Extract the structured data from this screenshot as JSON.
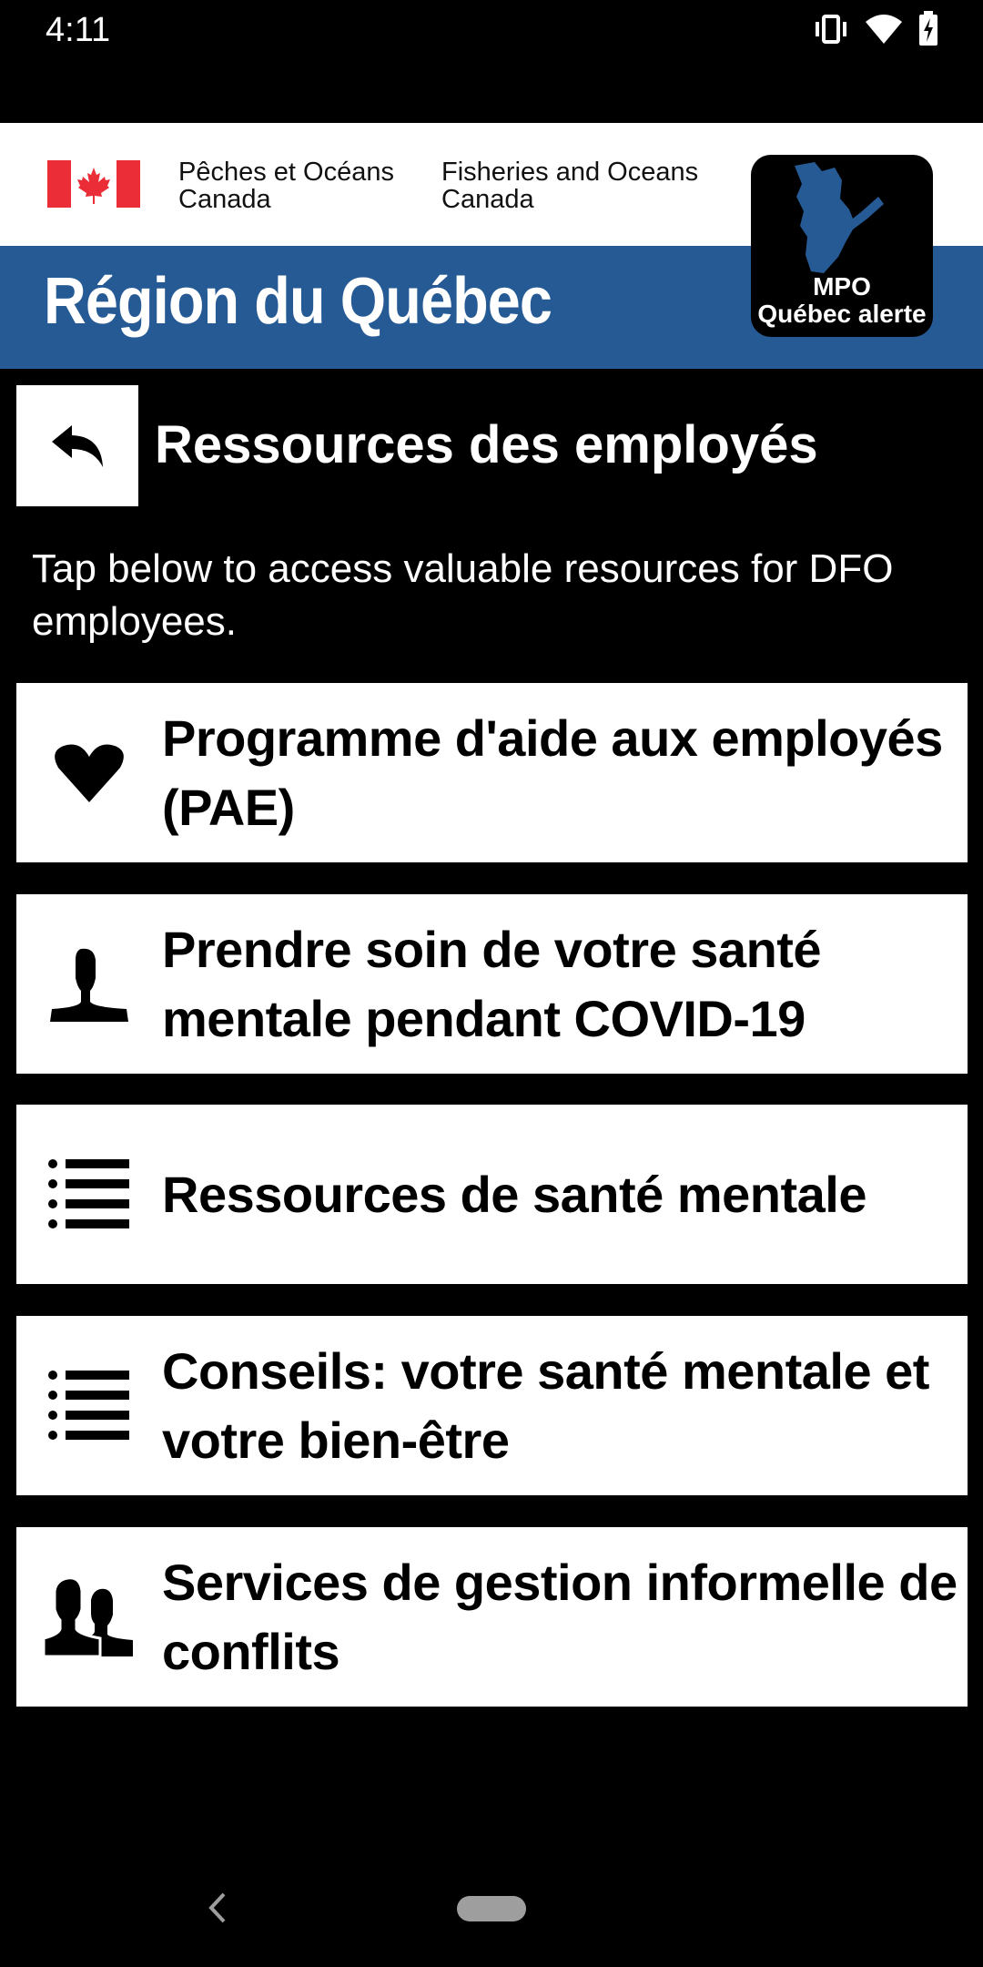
{
  "status_bar": {
    "time": "4:11",
    "icons": [
      "vibrate-icon",
      "wifi-icon",
      "battery-charging-icon"
    ]
  },
  "banner": {
    "department_fr": [
      "Pêches et Océans",
      "Canada"
    ],
    "department_en": [
      "Fisheries and Oceans",
      "Canada"
    ],
    "region_title": "Région du Québec",
    "logo": {
      "line1": "MPO",
      "line2": "Québec alerte"
    },
    "colors": {
      "banner_blue": "#265a94",
      "flag_red": "#eb2d37"
    }
  },
  "header": {
    "back_icon": "reply-arrow-icon",
    "title": "Ressources des employés"
  },
  "description": "Tap below to access valuable resources for DFO employees.",
  "resources": [
    {
      "icon": "heart-icon",
      "label": "Programme d'aide aux employés (PAE)"
    },
    {
      "icon": "person-icon",
      "label": "Prendre soin de votre santé mentale pendant COVID-19"
    },
    {
      "icon": "list-icon",
      "label": "Ressources de santé mentale"
    },
    {
      "icon": "list-icon",
      "label": "Conseils: votre santé mentale et votre bien-être"
    },
    {
      "icon": "group-icon",
      "label": "Services de gestion informelle de conflits"
    }
  ],
  "nav_bar": {
    "back": "back-chevron-icon",
    "home": "home-pill"
  }
}
